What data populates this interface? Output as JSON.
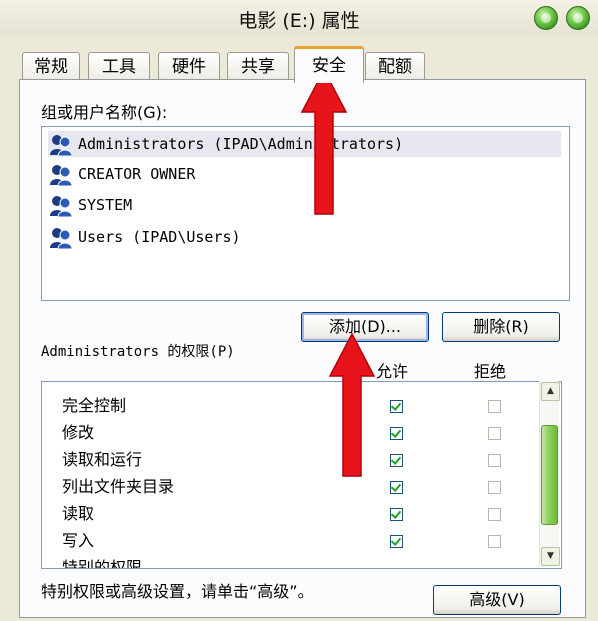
{
  "window": {
    "title": "电影 (E:) 属性"
  },
  "tabs": [
    {
      "label": "常规",
      "active": false
    },
    {
      "label": "工具",
      "active": false
    },
    {
      "label": "硬件",
      "active": false
    },
    {
      "label": "共享",
      "active": false
    },
    {
      "label": "安全",
      "active": true
    },
    {
      "label": "配额",
      "active": false
    }
  ],
  "groups": {
    "label": "组或用户名称(G):",
    "items": [
      "Administrators (IPAD\\Administrators)",
      "CREATOR OWNER",
      "SYSTEM",
      "Users (IPAD\\Users)"
    ],
    "selected_index": 0
  },
  "buttons": {
    "add": "添加(D)...",
    "remove": "删除(R)",
    "advanced": "高级(V)"
  },
  "permissions": {
    "label": "Administrators 的权限(P)",
    "allow_header": "允许",
    "deny_header": "拒绝",
    "rows": [
      {
        "name": "完全控制",
        "allow": true,
        "deny": false
      },
      {
        "name": "修改",
        "allow": true,
        "deny": false
      },
      {
        "name": "读取和运行",
        "allow": true,
        "deny": false
      },
      {
        "name": "列出文件夹目录",
        "allow": true,
        "deny": false
      },
      {
        "name": "读取",
        "allow": true,
        "deny": false
      },
      {
        "name": "写入",
        "allow": true,
        "deny": false
      },
      {
        "name": "特别的权限",
        "allow": false,
        "deny": false
      }
    ]
  },
  "footer": {
    "note": "特别权限或高级设置，请单击“高级”。"
  },
  "colors": {
    "arrow": "#e8141b",
    "tab_highlight": "#e8a032",
    "checkmark": "#21a121"
  }
}
